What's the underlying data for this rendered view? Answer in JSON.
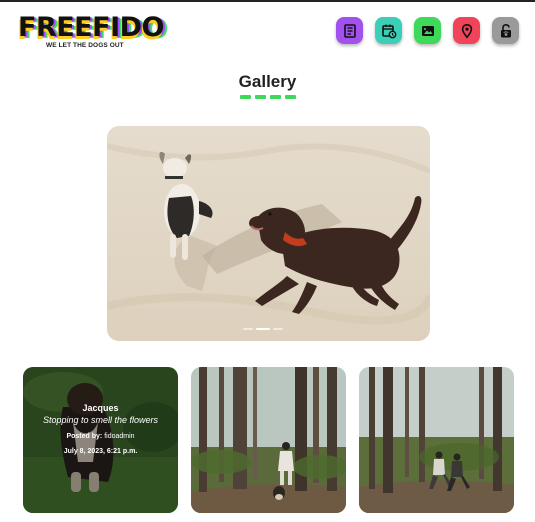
{
  "brand": {
    "name": "FREEFIDO",
    "tagline": "WE LET THE DOGS OUT"
  },
  "nav": [
    {
      "name": "news-icon",
      "color": "#a250ee"
    },
    {
      "name": "calendar-icon",
      "color": "#3ccfb8"
    },
    {
      "name": "photos-icon",
      "color": "#3ed95a"
    },
    {
      "name": "location-pin-icon",
      "color": "#f0445a"
    },
    {
      "name": "unlock-paw-icon",
      "color": "#9a9a9a"
    }
  ],
  "page": {
    "title": "Gallery",
    "accent": "#3ed95a"
  },
  "gallery": {
    "slide_count": 3,
    "active_slide": 1,
    "cards": [
      {
        "name": "Jacques",
        "caption": "Stopping to smell the flowers",
        "author_label": "Posted by:",
        "author": "fidoadmin",
        "date": "July 8, 2023, 6:21 p.m."
      },
      {},
      {}
    ]
  }
}
